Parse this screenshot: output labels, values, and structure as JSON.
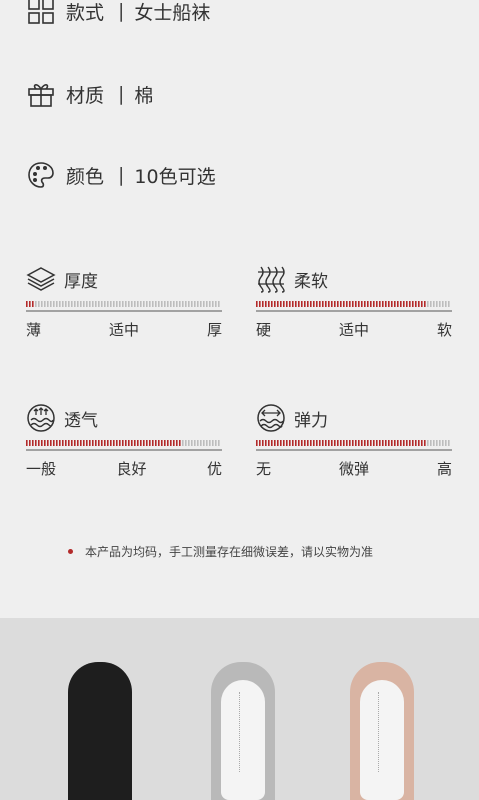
{
  "specs": [
    {
      "icon": "grid-icon",
      "label": "款式",
      "sep": "|",
      "value": "女士船袜"
    },
    {
      "icon": "gift-box-icon",
      "label": "材质",
      "sep": "|",
      "value": "棉"
    },
    {
      "icon": "palette-icon",
      "label": "颜色",
      "sep": "|",
      "value": "10色可选"
    }
  ],
  "meters": [
    {
      "icon": "layers-icon",
      "title": "厚度",
      "scale": [
        "薄",
        "适中",
        "厚"
      ],
      "level": 0.05
    },
    {
      "icon": "wave-lines-icon",
      "title": "柔软",
      "scale": [
        "硬",
        "适中",
        "软"
      ],
      "level": 0.88
    },
    {
      "icon": "breath-icon",
      "title": "透气",
      "scale": [
        "一般",
        "良好",
        "优"
      ],
      "level": 0.8
    },
    {
      "icon": "stretch-icon",
      "title": "弹力",
      "scale": [
        "无",
        "微弹",
        "高"
      ],
      "level": 0.88
    }
  ],
  "note": "本产品为均码，手工测量存在细微误差，请以实物为准",
  "colors": {
    "accent": "#b32a2a",
    "inactive": "#bdbdbd",
    "text": "#333333"
  },
  "socks": [
    {
      "name": "black-sock",
      "color": "#1e1e1e"
    },
    {
      "name": "grey-sock",
      "color": "#b9b9b9"
    },
    {
      "name": "pink-sock",
      "color": "#d9b4a3"
    }
  ]
}
